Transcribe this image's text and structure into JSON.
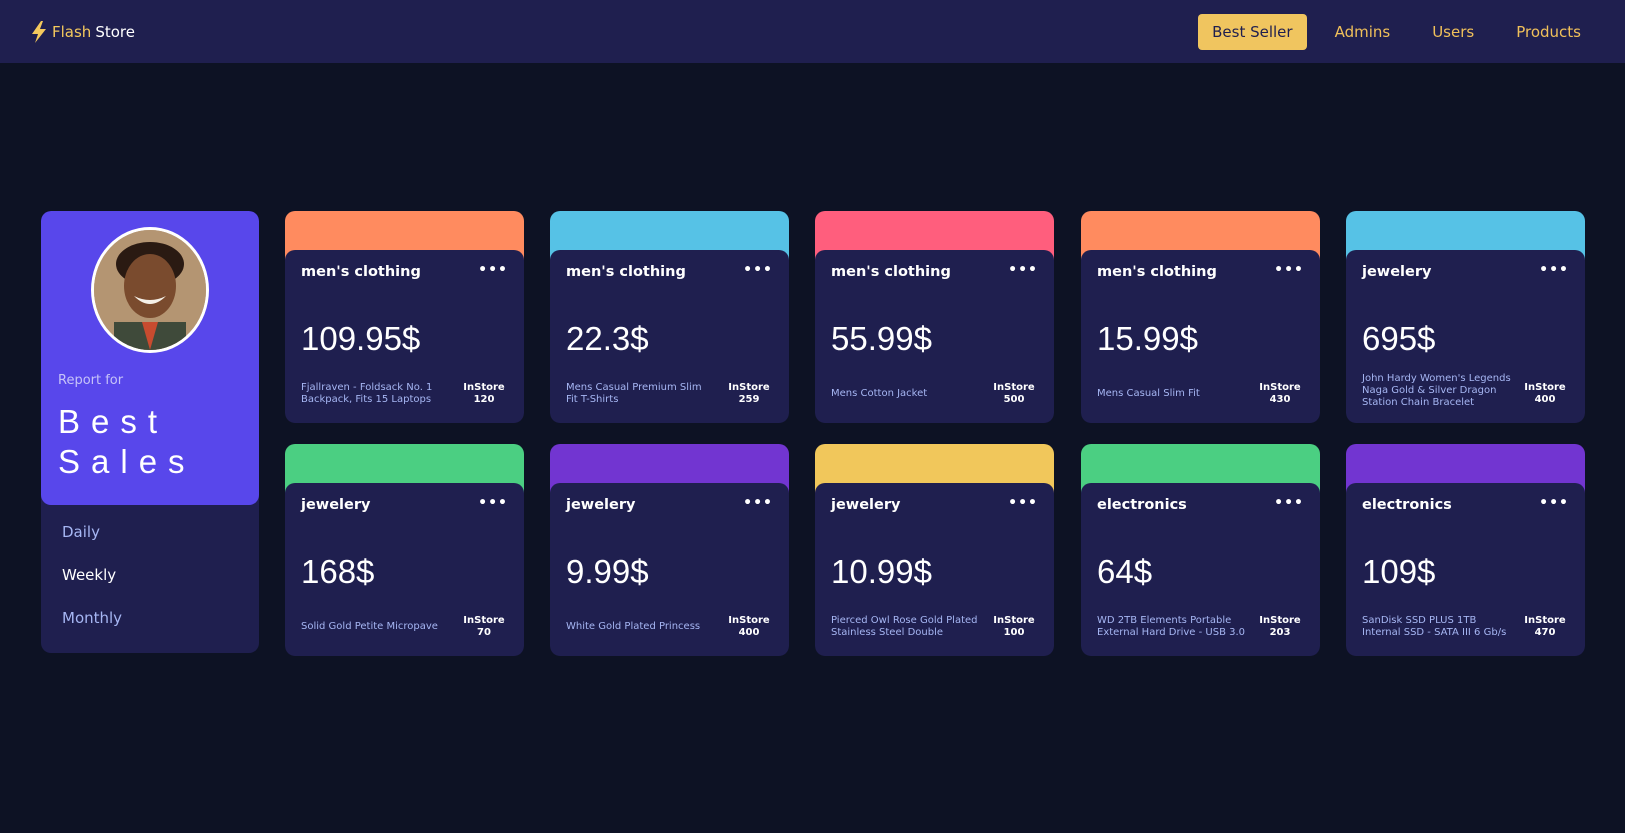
{
  "brand": {
    "flash": "Flash",
    "store": "Store",
    "icon": "lightning-bolt-icon"
  },
  "nav": {
    "items": [
      {
        "label": "Best Seller",
        "active": true
      },
      {
        "label": "Admins",
        "active": false
      },
      {
        "label": "Users",
        "active": false
      },
      {
        "label": "Products",
        "active": false
      }
    ]
  },
  "profile": {
    "report_for": "Report for",
    "title_line1": "Best",
    "title_line2": "Sales",
    "periods": [
      {
        "label": "Daily",
        "active": false
      },
      {
        "label": "Weekly",
        "active": true
      },
      {
        "label": "Monthly",
        "active": false
      }
    ]
  },
  "colors": {
    "accent": "#5847eb",
    "panel": "#1f1f4f",
    "background": "#0d1224",
    "gold": "#f0c55f",
    "orange": "#ff8b5f",
    "cyan": "#56c2e6",
    "pink": "#ff5e7d",
    "green": "#4bcf82",
    "violet": "#7235d1",
    "yellow": "#f1c75b"
  },
  "cards": [
    {
      "category": "men's clothing",
      "price": "109.95$",
      "description": "Fjallraven - Foldsack No. 1 Backpack, Fits 15 Laptops",
      "instore_label": "InStore",
      "stock": "120",
      "color": "#ff8b5f"
    },
    {
      "category": "men's clothing",
      "price": "22.3$",
      "description": "Mens Casual Premium Slim Fit T-Shirts",
      "instore_label": "InStore",
      "stock": "259",
      "color": "#56c2e6"
    },
    {
      "category": "men's clothing",
      "price": "55.99$",
      "description": "Mens Cotton Jacket",
      "instore_label": "InStore",
      "stock": "500",
      "color": "#ff5e7d"
    },
    {
      "category": "men's clothing",
      "price": "15.99$",
      "description": "Mens Casual Slim Fit",
      "instore_label": "InStore",
      "stock": "430",
      "color": "#ff8b5f"
    },
    {
      "category": "jewelery",
      "price": "695$",
      "description": "John Hardy Women's Legends Naga Gold & Silver Dragon Station Chain Bracelet",
      "instore_label": "InStore",
      "stock": "400",
      "color": "#56c2e6"
    },
    {
      "category": "jewelery",
      "price": "168$",
      "description": "Solid Gold Petite Micropave",
      "instore_label": "InStore",
      "stock": "70",
      "color": "#4bcf82"
    },
    {
      "category": "jewelery",
      "price": "9.99$",
      "description": "White Gold Plated Princess",
      "instore_label": "InStore",
      "stock": "400",
      "color": "#7235d1"
    },
    {
      "category": "jewelery",
      "price": "10.99$",
      "description": "Pierced Owl Rose Gold Plated Stainless Steel Double",
      "instore_label": "InStore",
      "stock": "100",
      "color": "#f1c75b"
    },
    {
      "category": "electronics",
      "price": "64$",
      "description": "WD 2TB Elements Portable External Hard Drive - USB 3.0",
      "instore_label": "InStore",
      "stock": "203",
      "color": "#4bcf82"
    },
    {
      "category": "electronics",
      "price": "109$",
      "description": "SanDisk SSD PLUS 1TB Internal SSD - SATA III 6 Gb/s",
      "instore_label": "InStore",
      "stock": "470",
      "color": "#7235d1"
    }
  ]
}
